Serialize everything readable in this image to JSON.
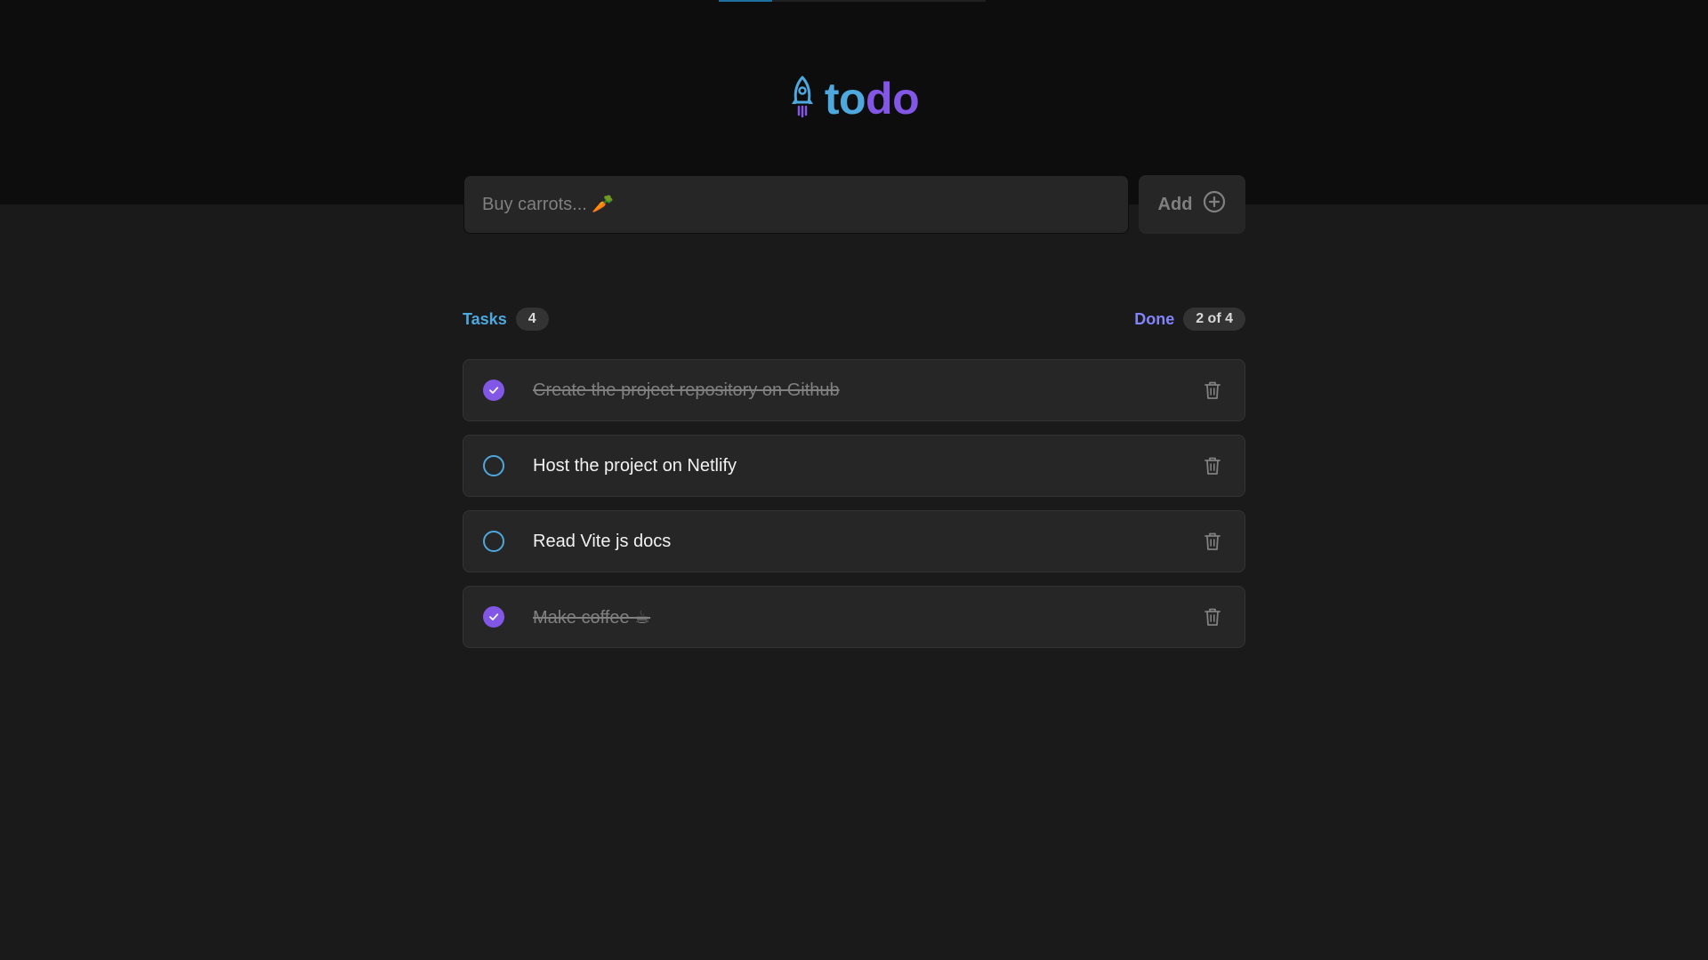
{
  "app": {
    "logo_part1": "to",
    "logo_part2": "do",
    "logo_icon": "rocket-icon"
  },
  "add_task": {
    "placeholder": "Buy carrots... 🥕",
    "value": "",
    "button_label": "Add",
    "button_icon": "plus-circle-icon"
  },
  "summary": {
    "created_label": "Tasks",
    "created_count": "4",
    "done_label": "Done",
    "done_count": "2 of 4"
  },
  "tasks": [
    {
      "text": "Create the project repository on Github",
      "done": true
    },
    {
      "text": "Host the project on Netlify",
      "done": false
    },
    {
      "text": "Read Vite js docs",
      "done": false
    },
    {
      "text": "Make coffee ☕",
      "done": true
    }
  ],
  "colors": {
    "blue": "#4ea8de",
    "purple": "#8257e5",
    "background": "#1a1a1a",
    "header": "#0d0d0d",
    "card": "#262626"
  }
}
